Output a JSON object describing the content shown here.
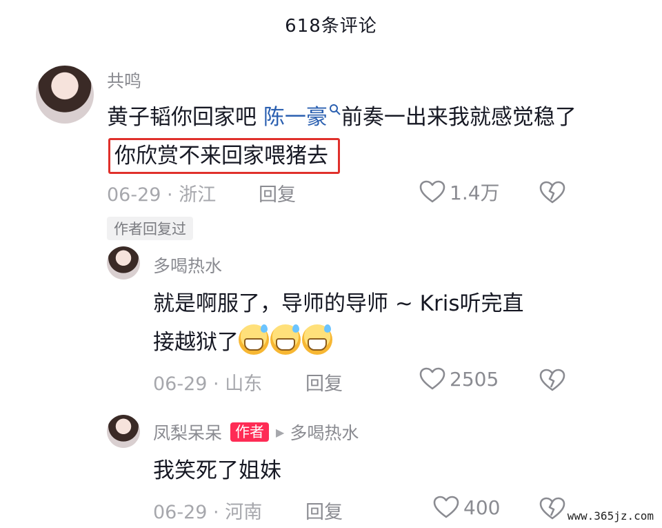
{
  "header": {
    "title": "618条评论"
  },
  "comments": [
    {
      "username": "共鸣",
      "text_main": "黄子韬你回家吧 ",
      "mention": "陈一豪",
      "text_after_mention": "前奏一出来我就感觉稳了",
      "highlighted_text": "你欣赏不来回家喂猪去",
      "date_location": "06-29 · 浙江",
      "reply_label": "回复",
      "likes": "1.4万",
      "author_replied_badge": "作者回复过"
    }
  ],
  "replies": [
    {
      "username": "多喝热水",
      "text_line1": "就是啊服了，导师的导师 ~ Kris听完直",
      "text_line2": "接越狱了",
      "emoji_name": "grinning-sweat-emoji",
      "emoji_count": 3,
      "date_location": "06-29 · 山东",
      "reply_label": "回复",
      "likes": "2505"
    },
    {
      "username": "凤梨呆呆",
      "author_tag": "作者",
      "reply_to": "多喝热水",
      "text": "我笑死了姐妹",
      "date_location": "06-29 · 河南",
      "reply_label": "回复",
      "likes": "400"
    }
  ],
  "icons": {
    "like": "heart-outline-icon",
    "dislike": "broken-heart-icon",
    "reply_arrow": "triangle-right-icon",
    "search": "search-icon"
  },
  "colors": {
    "accent": "#fe2c55",
    "mention": "#2a5fb0",
    "highlight_border": "#e0302b"
  },
  "watermark": "www.365jz.com"
}
